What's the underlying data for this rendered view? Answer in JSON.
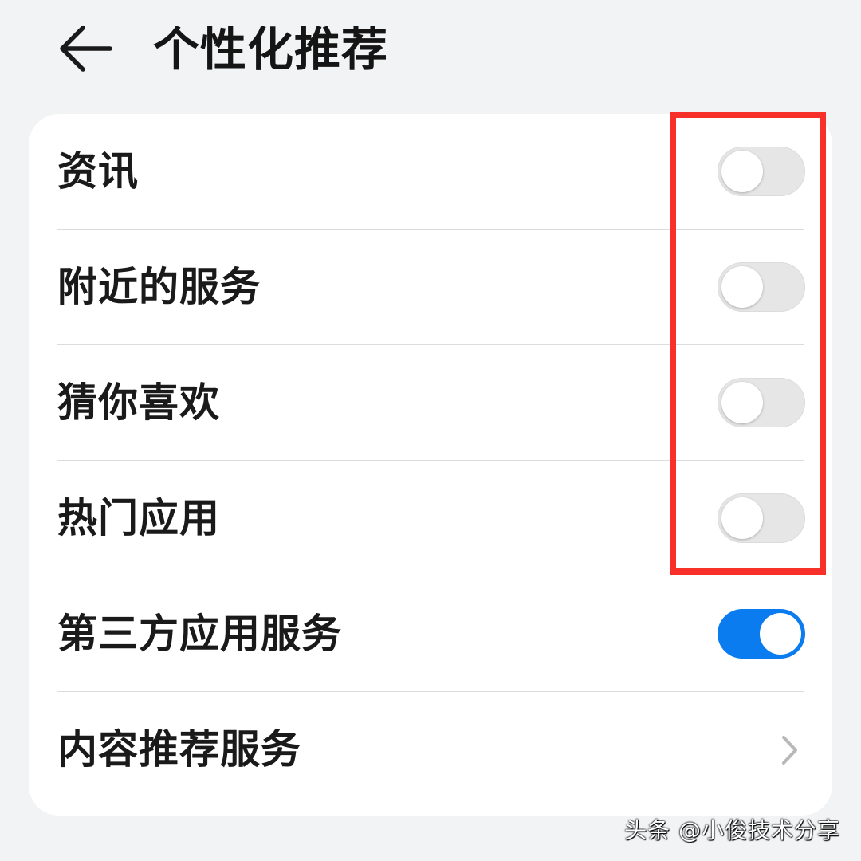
{
  "header": {
    "title": "个性化推荐",
    "back_icon": "arrow-left-icon"
  },
  "settings": {
    "items": [
      {
        "label": "资讯",
        "control": "toggle",
        "enabled": false
      },
      {
        "label": "附近的服务",
        "control": "toggle",
        "enabled": false
      },
      {
        "label": "猜你喜欢",
        "control": "toggle",
        "enabled": false
      },
      {
        "label": "热门应用",
        "control": "toggle",
        "enabled": false
      },
      {
        "label": "第三方应用服务",
        "control": "toggle",
        "enabled": true
      },
      {
        "label": "内容推荐服务",
        "control": "chevron",
        "icon": "chevron-right-icon"
      }
    ]
  },
  "colors": {
    "toggle_on": "#0a7cf0",
    "toggle_off": "#e6e6e6",
    "highlight_border": "#f7312a",
    "background": "#f1f3f5"
  },
  "watermark": {
    "text": "头条 @小俊技术分享"
  }
}
